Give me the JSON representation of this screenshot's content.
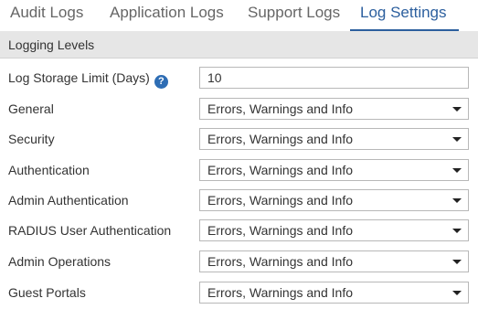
{
  "tabs": [
    {
      "label": "Audit Logs",
      "active": false
    },
    {
      "label": "Application Logs",
      "active": false
    },
    {
      "label": "Support Logs",
      "active": false
    },
    {
      "label": "Log Settings",
      "active": true
    }
  ],
  "section": {
    "title": "Logging Levels"
  },
  "storage": {
    "label": "Log Storage Limit (Days)",
    "help_icon": "?",
    "value": "10"
  },
  "rows": [
    {
      "label": "General",
      "value": "Errors, Warnings and Info"
    },
    {
      "label": "Security",
      "value": "Errors, Warnings and Info"
    },
    {
      "label": "Authentication",
      "value": "Errors, Warnings and Info"
    },
    {
      "label": "Admin Authentication",
      "value": "Errors, Warnings and Info"
    },
    {
      "label": "RADIUS User Authentication",
      "value": "Errors, Warnings and Info"
    },
    {
      "label": "Admin Operations",
      "value": "Errors, Warnings and Info"
    },
    {
      "label": "Guest Portals",
      "value": "Errors, Warnings and Info"
    }
  ],
  "colors": {
    "accent": "#2c5f9e",
    "help_icon": "#2e6db4",
    "header_bg": "#e6e6e6"
  }
}
